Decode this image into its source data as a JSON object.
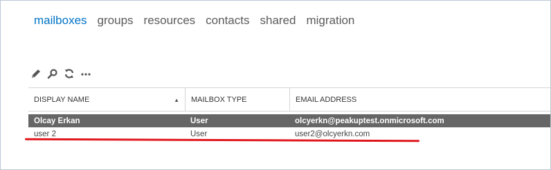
{
  "nav": {
    "tabs": [
      {
        "label": "mailboxes",
        "active": true
      },
      {
        "label": "groups",
        "active": false
      },
      {
        "label": "resources",
        "active": false
      },
      {
        "label": "contacts",
        "active": false
      },
      {
        "label": "shared",
        "active": false
      },
      {
        "label": "migration",
        "active": false
      }
    ]
  },
  "toolbar": {
    "icons": [
      "edit-pencil-icon",
      "search-icon",
      "refresh-icon",
      "more-icon"
    ]
  },
  "table": {
    "columns": [
      "DISPLAY NAME",
      "MAILBOX TYPE",
      "EMAIL ADDRESS"
    ],
    "sort_indicator": "▲",
    "rows": [
      {
        "display_name": "Olcay Erkan",
        "mailbox_type": "User",
        "email": "olcyerkn@peakuptest.onmicrosoft.com",
        "selected": true
      },
      {
        "display_name": "user 2",
        "mailbox_type": "User",
        "email": "user2@olcyerkn.com",
        "selected": false
      }
    ]
  },
  "colors": {
    "accent": "#0072c6",
    "selected_row": "#666666",
    "annotation_underline": "#e0161d"
  }
}
